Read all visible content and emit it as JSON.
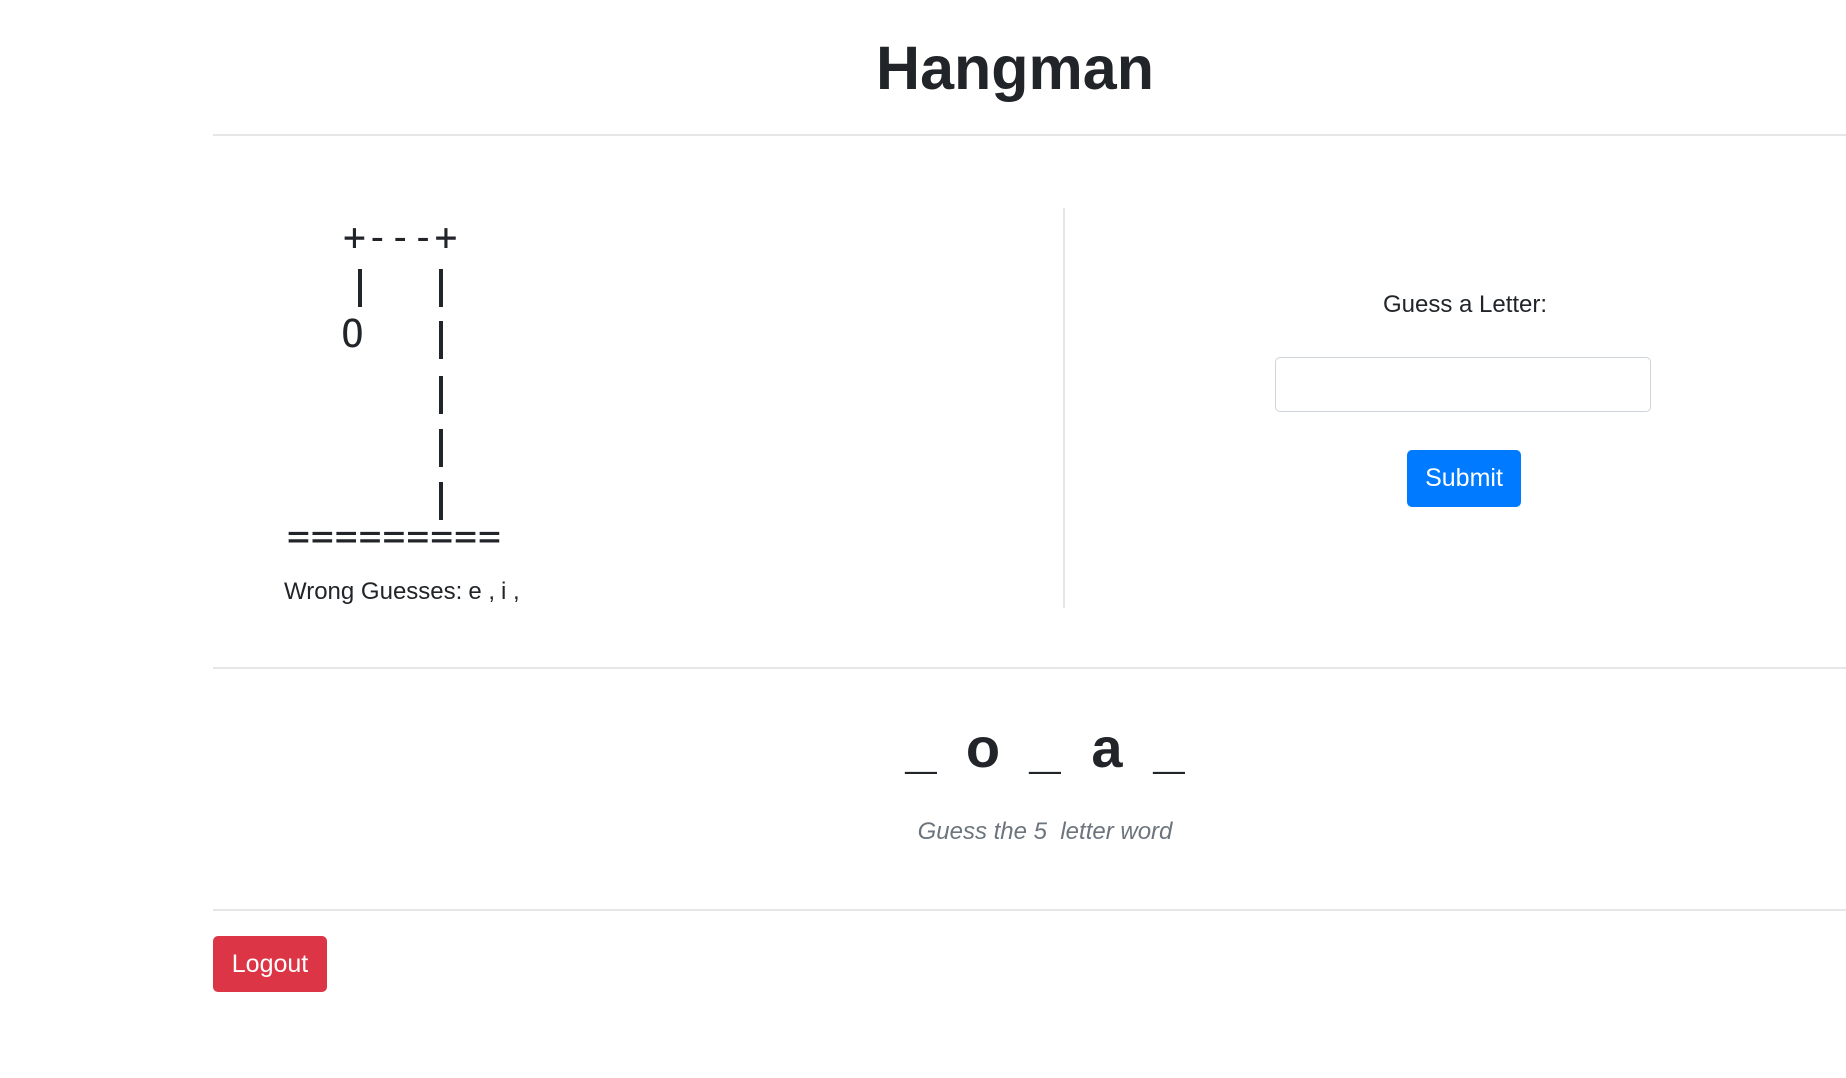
{
  "header": {
    "title": "Hangman"
  },
  "gallows": {
    "top": "+---+",
    "head": "O",
    "base": "========="
  },
  "wrong_guesses": {
    "label": "Wrong Guesses:",
    "letters": [
      "e ,",
      "i ,"
    ]
  },
  "guess_form": {
    "label": "Guess a Letter:",
    "input_value": "",
    "input_placeholder": "",
    "submit_label": "Submit"
  },
  "word": {
    "characters": [
      "_",
      "o",
      "_",
      "a",
      "_"
    ],
    "hint": "Guess the 5  letter word"
  },
  "footer": {
    "logout_label": "Logout"
  },
  "colors": {
    "primary": "#007bff",
    "danger": "#dc3545",
    "text": "#212529",
    "muted": "#6c757d"
  }
}
